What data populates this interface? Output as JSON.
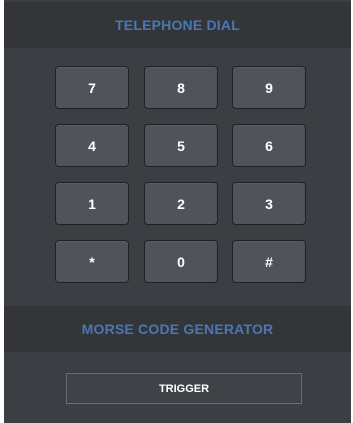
{
  "colors": {
    "header_text": "#4a78b5",
    "panel_bg": "#3b3e42",
    "header_bg": "#333538",
    "key_bg": "#50545a",
    "key_text": "#ffffff"
  },
  "telephone_dial": {
    "title": "TELEPHONE DIAL",
    "keys": [
      "7",
      "8",
      "9",
      "4",
      "5",
      "6",
      "1",
      "2",
      "3",
      "*",
      "0",
      "#"
    ]
  },
  "morse": {
    "title": "MORSE CODE GENERATOR",
    "trigger_label": "TRIGGER"
  }
}
